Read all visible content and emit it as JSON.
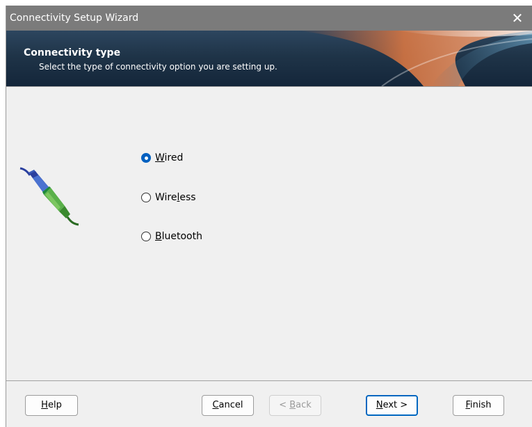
{
  "window": {
    "title": "Connectivity Setup Wizard",
    "close_glyph": "✕"
  },
  "header": {
    "heading": "Connectivity type",
    "description": "Select the type of connectivity option you are setting up."
  },
  "options": [
    {
      "prefix": "",
      "key": "W",
      "suffix": "ired",
      "selected": true
    },
    {
      "prefix": "Wire",
      "key": "l",
      "suffix": "ess",
      "selected": false
    },
    {
      "prefix": "",
      "key": "B",
      "suffix": "luetooth",
      "selected": false
    }
  ],
  "buttons": {
    "help": {
      "prefix": "",
      "key": "H",
      "suffix": "elp"
    },
    "cancel": {
      "prefix": "",
      "key": "C",
      "suffix": "ancel"
    },
    "back": {
      "prefix": "< ",
      "key": "B",
      "suffix": "ack",
      "disabled": true
    },
    "next": {
      "prefix": "",
      "key": "N",
      "suffix": "ext >",
      "default": true
    },
    "finish": {
      "prefix": "",
      "key": "F",
      "suffix": "inish"
    }
  },
  "colors": {
    "accent": "#0067c0",
    "title_bar": "#7b7b7b",
    "banner": "#1f3448"
  },
  "icons": {
    "wizard_image": "network-cable-plug-icon",
    "radio_selected": "radio-selected-icon"
  }
}
